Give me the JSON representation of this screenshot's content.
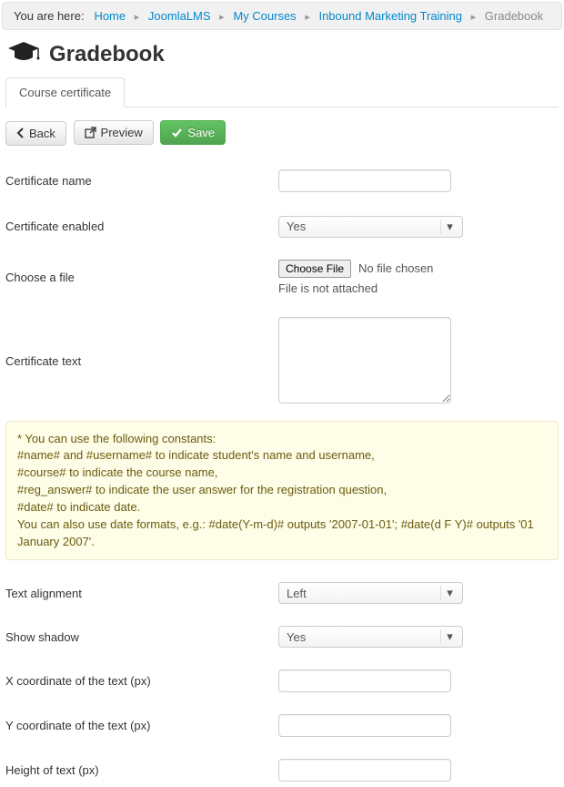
{
  "breadcrumb": {
    "prefix": "You are here:",
    "items": [
      "Home",
      "JoomlaLMS",
      "My Courses",
      "Inbound Marketing Training"
    ],
    "current": "Gradebook"
  },
  "page": {
    "title": "Gradebook"
  },
  "tabs": {
    "active": "Course certificate"
  },
  "toolbar": {
    "back": "Back",
    "preview": "Preview",
    "save": "Save"
  },
  "form": {
    "cert_name": {
      "label": "Certificate name",
      "value": ""
    },
    "cert_enabled": {
      "label": "Certificate enabled",
      "value": "Yes"
    },
    "choose_file": {
      "label": "Choose a file",
      "button": "Choose File",
      "status": "No file chosen",
      "note": "File is not attached"
    },
    "cert_text": {
      "label": "Certificate text",
      "value": ""
    },
    "text_align": {
      "label": "Text alignment",
      "value": "Left"
    },
    "show_shadow": {
      "label": "Show shadow",
      "value": "Yes"
    },
    "x_coord": {
      "label": "X coordinate of the text (px)",
      "value": ""
    },
    "y_coord": {
      "label": "Y coordinate of the text (px)",
      "value": ""
    },
    "height": {
      "label": "Height of text (px)",
      "value": ""
    }
  },
  "help": {
    "l1": "* You can use the following constants:",
    "l2": "#name# and #username# to indicate student's name and username,",
    "l3": "#course# to indicate the course name,",
    "l4": "#reg_answer# to indicate the user answer for the registration question,",
    "l5": "#date# to indicate date.",
    "l6": "You can also use date formats, e.g.: #date(Y-m-d)# outputs '2007-01-01'; #date(d F Y)# outputs '01 January 2007'."
  }
}
